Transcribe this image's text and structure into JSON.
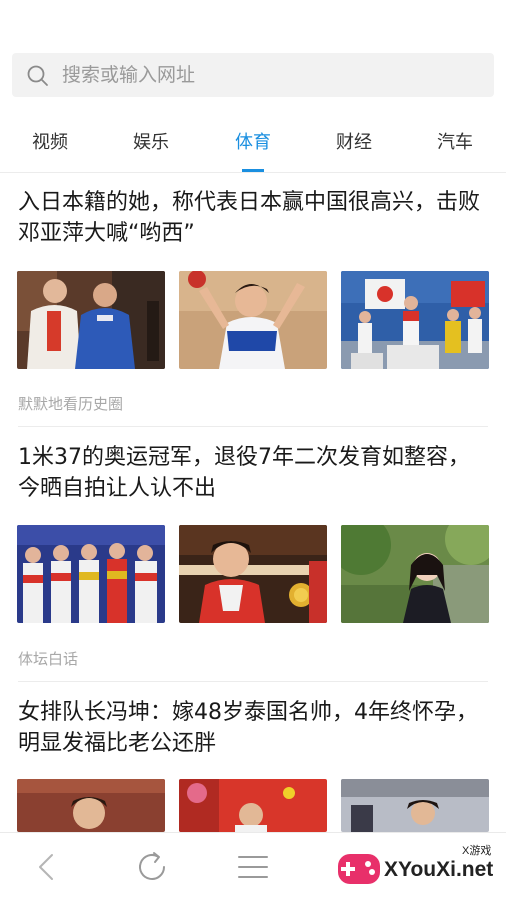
{
  "search": {
    "placeholder": "搜索或输入网址",
    "icon": "search-icon"
  },
  "tabs": [
    {
      "label": "视频",
      "active": false
    },
    {
      "label": "娱乐",
      "active": false
    },
    {
      "label": "体育",
      "active": true
    },
    {
      "label": "财经",
      "active": false
    },
    {
      "label": "汽车",
      "active": false
    }
  ],
  "accent_color": "#1a8fe0",
  "articles": [
    {
      "title": "入日本籍的她，称代表日本赢中国很高兴，击败邓亚萍大喊“哟西”",
      "source": "默默地看历史圈"
    },
    {
      "title": "1米37的奥运冠军，退役7年二次发育如整容，今晒自拍让人认不出",
      "source": "体坛白话"
    },
    {
      "title": "女排队长冯坤：嫁48岁泰国名帅，4年终怀孕，明显发福比老公还胖",
      "source": ""
    }
  ],
  "bottom_nav": {
    "back": "back-icon",
    "refresh": "refresh-icon",
    "menu": "menu-icon"
  },
  "watermark": {
    "text": "XYouXi.net",
    "small": "X游戏"
  }
}
